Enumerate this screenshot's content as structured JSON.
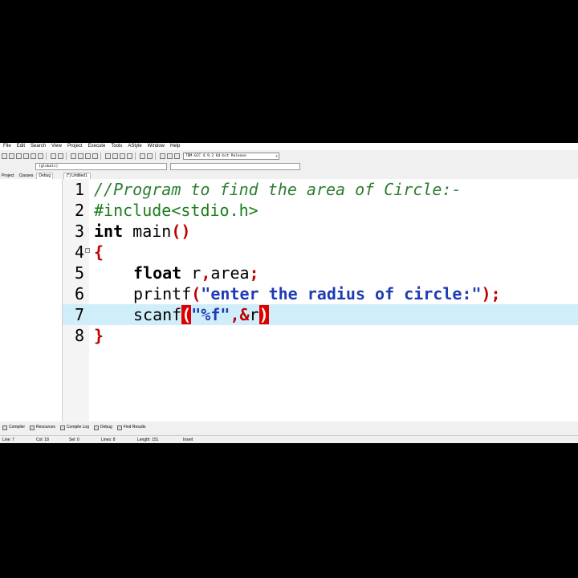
{
  "menu": [
    "File",
    "Edit",
    "Search",
    "View",
    "Project",
    "Execute",
    "Tools",
    "AStyle",
    "Window",
    "Help"
  ],
  "toolbar": {
    "compiler": "TDM-GCC 4.9.2 64-bit Release",
    "scope": "(globals)"
  },
  "left_tabs": [
    "Project",
    "Classes",
    "Debug"
  ],
  "editor_tab": "[*] Untitled1",
  "code": {
    "current_line": 7,
    "lines": [
      {
        "num": "1",
        "text": "//Program to find the area of Circle:-"
      },
      {
        "num": "2",
        "text": "#include<stdio.h>"
      },
      {
        "num": "3",
        "kw": "int",
        "rest": " main",
        "paren_open": "(",
        "paren_close": ")"
      },
      {
        "num": "4",
        "brace": "{"
      },
      {
        "num": "5",
        "kw": "float",
        "rest": " r",
        "comma": ",",
        "rest2": "area",
        "semi": ";"
      },
      {
        "num": "6",
        "fn": "printf",
        "paren_open": "(",
        "str": "\"enter the radius of circle:\"",
        "paren_close": ")",
        "semi": ";"
      },
      {
        "num": "7",
        "fn": "scanf",
        "paren_open": "(",
        "str": "\"%f\"",
        "comma": ",",
        "amp": "&",
        "var": "r",
        "paren_close": ")"
      },
      {
        "num": "8",
        "brace": "}"
      }
    ]
  },
  "bottom_tabs": [
    "Compiler",
    "Resources",
    "Compile Log",
    "Debug",
    "Find Results"
  ],
  "status": {
    "line_label": "Line:",
    "line": "7",
    "col_label": "Col:",
    "col": "18",
    "sel_label": "Sel:",
    "sel": "0",
    "lines_label": "Lines:",
    "lines": "8",
    "length_label": "Length:",
    "length": "151",
    "mode": "Insert"
  },
  "colors": {
    "comment": "#2e7d32",
    "string": "#1f3bb3",
    "operator": "#c00000",
    "current_line_bg": "#cfeefa",
    "bracket_match_bg": "#e00000"
  }
}
